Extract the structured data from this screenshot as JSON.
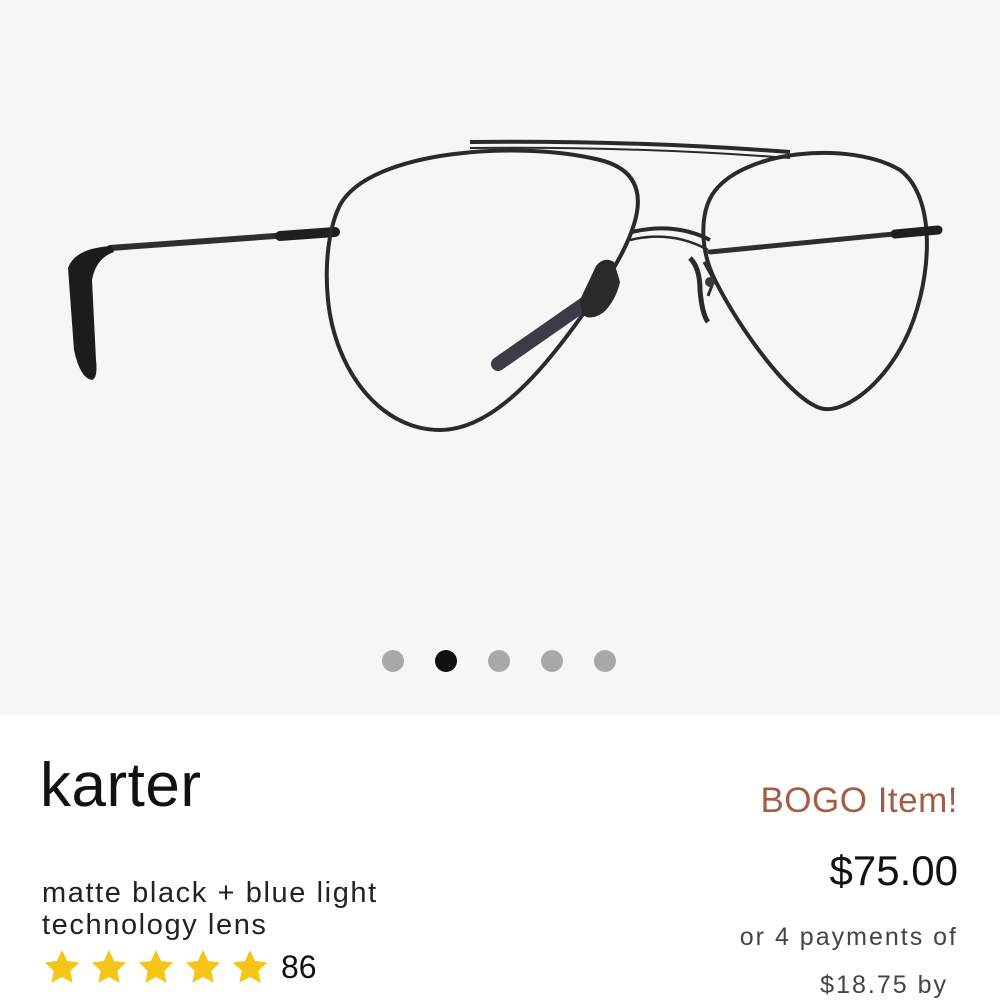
{
  "gallery": {
    "image_name": "aviator-eyeglasses-photo",
    "dot_count": 5,
    "active_index": 1
  },
  "product": {
    "name": "karter",
    "variant": "matte black + blue light technology lens",
    "rating": {
      "stars": 5,
      "review_count": "86",
      "star_color": "#f5c518"
    }
  },
  "pricing": {
    "promo": "BOGO Item!",
    "promo_color": "#a45d45",
    "price": "$75.00",
    "installments_text": "or 4 payments of",
    "installment_amount": "$18.75 by"
  }
}
